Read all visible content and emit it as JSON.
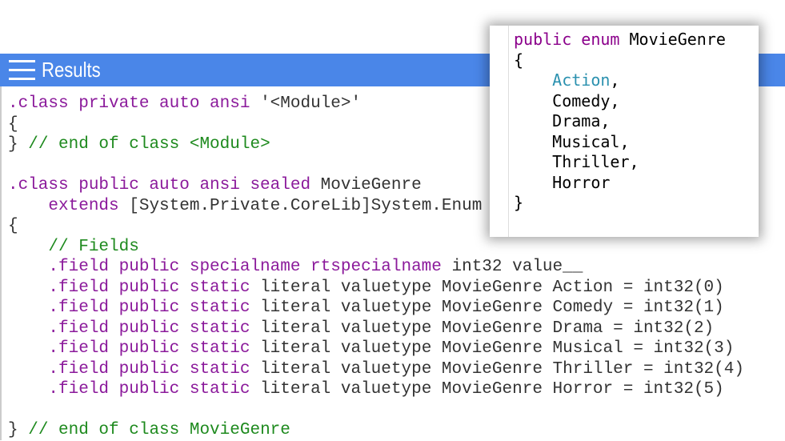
{
  "header": {
    "title": "Results",
    "menu_icon": "hamburger-menu-icon"
  },
  "il_code": [
    [
      {
        "t": ".class private auto ansi ",
        "c": "kw"
      },
      {
        "t": "'<Module>'",
        "c": "tx"
      }
    ],
    [
      {
        "t": "{",
        "c": "tx"
      }
    ],
    [
      {
        "t": "} ",
        "c": "tx"
      },
      {
        "t": "// end of class <Module>",
        "c": "cm"
      }
    ],
    [],
    [
      {
        "t": ".class public auto ansi sealed ",
        "c": "kw"
      },
      {
        "t": "MovieGenre",
        "c": "tx"
      }
    ],
    [
      {
        "t": "    extends ",
        "c": "kw"
      },
      {
        "t": "[System.Private.CoreLib]System.Enum",
        "c": "tx"
      }
    ],
    [
      {
        "t": "{",
        "c": "tx"
      }
    ],
    [
      {
        "t": "    // Fields",
        "c": "cm"
      }
    ],
    [
      {
        "t": "    .field public specialname rtspecialname ",
        "c": "kw"
      },
      {
        "t": "int32 value__",
        "c": "tx"
      }
    ],
    [
      {
        "t": "    .field public static ",
        "c": "kw"
      },
      {
        "t": "literal valuetype MovieGenre Action = int32(0)",
        "c": "tx"
      }
    ],
    [
      {
        "t": "    .field public static ",
        "c": "kw"
      },
      {
        "t": "literal valuetype MovieGenre Comedy = int32(1)",
        "c": "tx"
      }
    ],
    [
      {
        "t": "    .field public static ",
        "c": "kw"
      },
      {
        "t": "literal valuetype MovieGenre Drama = int32(2)",
        "c": "tx"
      }
    ],
    [
      {
        "t": "    .field public static ",
        "c": "kw"
      },
      {
        "t": "literal valuetype MovieGenre Musical = int32(3)",
        "c": "tx"
      }
    ],
    [
      {
        "t": "    .field public static ",
        "c": "kw"
      },
      {
        "t": "literal valuetype MovieGenre Thriller = int32(4)",
        "c": "tx"
      }
    ],
    [
      {
        "t": "    .field public static ",
        "c": "kw"
      },
      {
        "t": "literal valuetype MovieGenre Horror = int32(5)",
        "c": "tx"
      }
    ],
    [],
    [
      {
        "t": "} ",
        "c": "tx"
      },
      {
        "t": "// end of class MovieGenre",
        "c": "cm"
      }
    ]
  ],
  "csharp_code": [
    [
      {
        "t": "public enum ",
        "c": "kw"
      },
      {
        "t": "MovieGenre",
        "c": "tx"
      }
    ],
    [
      {
        "t": "{",
        "c": "tx"
      }
    ],
    [
      {
        "t": "    ",
        "c": "tx"
      },
      {
        "t": "Action",
        "c": "id"
      },
      {
        "t": ",",
        "c": "tx"
      }
    ],
    [
      {
        "t": "    Comedy,",
        "c": "tx"
      }
    ],
    [
      {
        "t": "    Drama,",
        "c": "tx"
      }
    ],
    [
      {
        "t": "    Musical,",
        "c": "tx"
      }
    ],
    [
      {
        "t": "    Thriller,",
        "c": "tx"
      }
    ],
    [
      {
        "t": "    Horror",
        "c": "tx"
      }
    ],
    [
      {
        "t": "}",
        "c": "tx"
      }
    ]
  ],
  "colors": {
    "header_bg": "#4a86e8",
    "keyword": "#8b1a9b",
    "comment": "#1e8a1e",
    "identifier": "#2b91af"
  }
}
